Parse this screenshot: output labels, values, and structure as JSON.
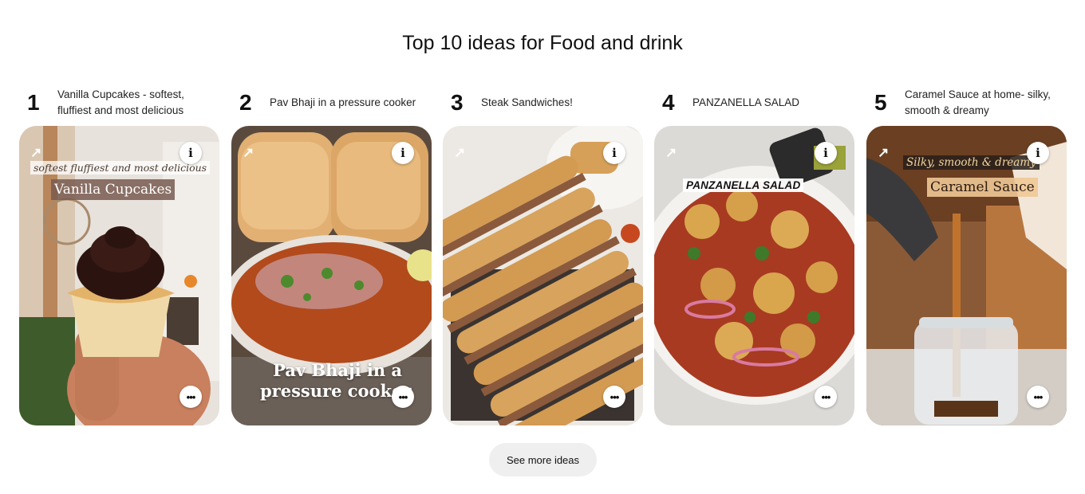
{
  "page": {
    "title": "Top 10 ideas for Food and drink"
  },
  "cards": [
    {
      "rank": "1",
      "caption": "Vanilla Cupcakes - softest, fluffiest and most delicious",
      "overlay_line1": "softest fluffiest and most delicious",
      "overlay_line2": "Vanilla Cupcakes"
    },
    {
      "rank": "2",
      "caption": "Pav Bhaji in a pressure cooker",
      "overlay_line1": "Pav Bhaji in a",
      "overlay_line2": "pressure cooker"
    },
    {
      "rank": "3",
      "caption": "Steak Sandwiches!"
    },
    {
      "rank": "4",
      "caption": "PANZANELLA SALAD",
      "overlay_line1": "PANZANELLA SALAD"
    },
    {
      "rank": "5",
      "caption": "Caramel Sauce at home- silky, smooth & dreamy",
      "overlay_line1": "Silky, smooth & dreamy",
      "overlay_line2": "Caramel Sauce"
    }
  ],
  "icons": {
    "arrow": "↗",
    "info": "i",
    "more": "•••"
  },
  "actions": {
    "see_more": "See more ideas"
  }
}
